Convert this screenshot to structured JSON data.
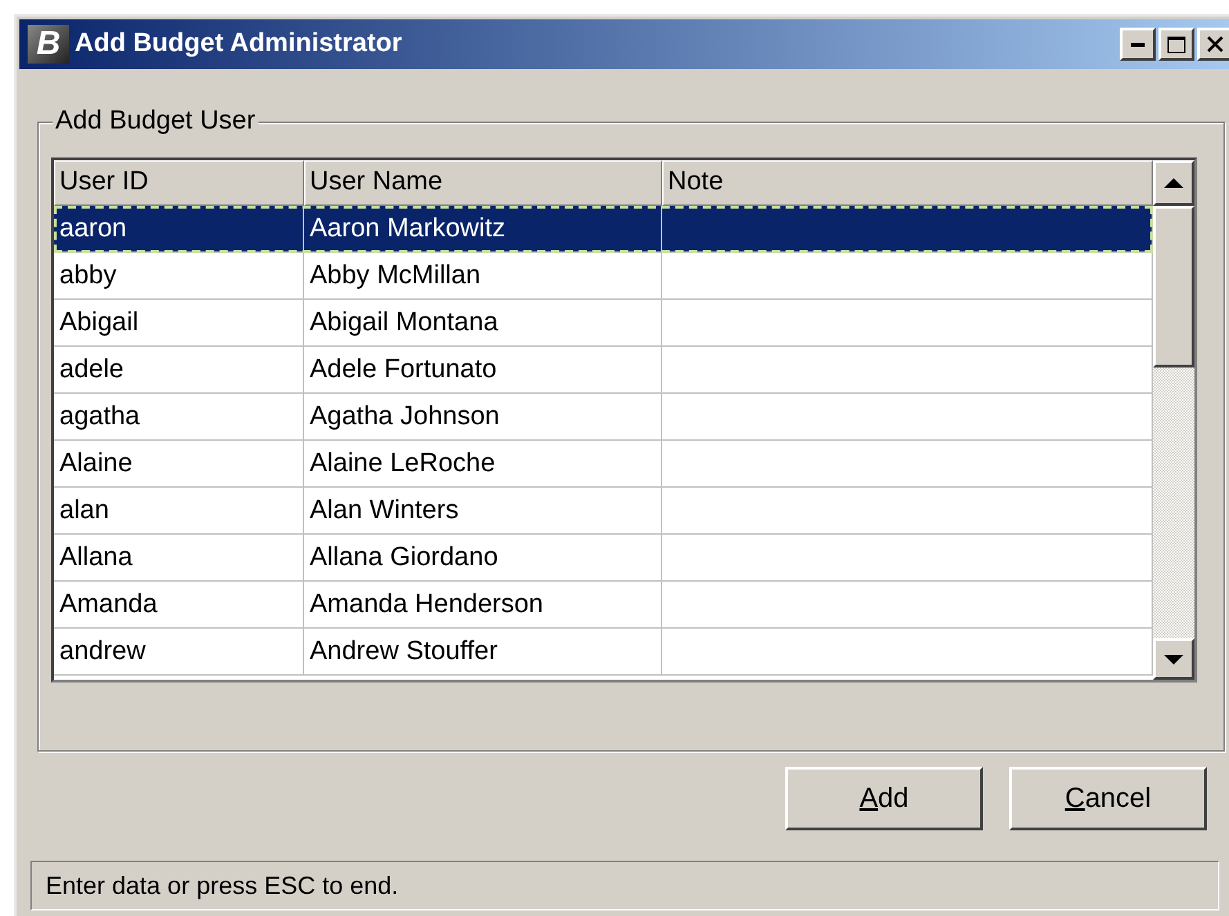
{
  "window": {
    "title": "Add Budget Administrator",
    "logo": "B"
  },
  "group": {
    "label": "Add Budget User"
  },
  "table": {
    "columns": [
      "User ID",
      "User Name",
      "Note"
    ],
    "rows": [
      {
        "cells": [
          "aaron",
          "Aaron Markowitz"
        ],
        "selected": true
      },
      {
        "cells": [
          "abby",
          "Abby McMillan"
        ],
        "selected": false
      },
      {
        "cells": [
          "Abigail",
          "Abigail Montana"
        ],
        "selected": false
      },
      {
        "cells": [
          "adele",
          "Adele Fortunato"
        ],
        "selected": false
      },
      {
        "cells": [
          "agatha",
          "Agatha Johnson"
        ],
        "selected": false
      },
      {
        "cells": [
          "Alaine",
          "Alaine LeRoche"
        ],
        "selected": false
      },
      {
        "cells": [
          "alan",
          "Alan Winters"
        ],
        "selected": false
      },
      {
        "cells": [
          "Allana",
          "Allana Giordano"
        ],
        "selected": false
      },
      {
        "cells": [
          "Amanda",
          "Amanda Henderson"
        ],
        "selected": false
      },
      {
        "cells": [
          "andrew",
          "Andrew Stouffer"
        ],
        "selected": false
      }
    ]
  },
  "buttons": [
    {
      "label": "Add",
      "accel_underlined": true
    },
    {
      "label": "Cancel",
      "accel_underlined": true
    }
  ],
  "status_bar": "Enter data or press ESC to end."
}
